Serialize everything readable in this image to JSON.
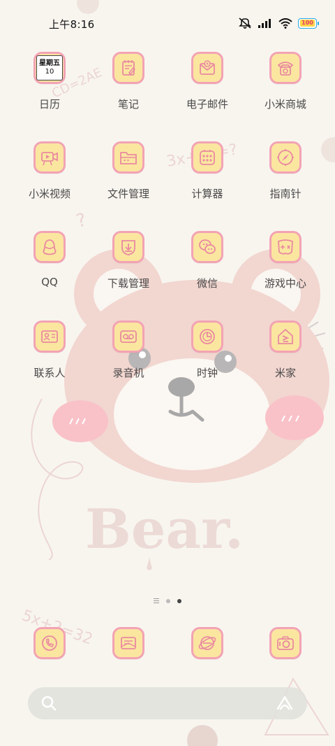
{
  "status_bar": {
    "time": "上午8:16",
    "battery_level": "100",
    "icons": [
      "mute-icon",
      "signal-icon",
      "wifi-icon",
      "battery-icon"
    ]
  },
  "calendar_icon": {
    "weekday": "星期五",
    "day": "10"
  },
  "apps": [
    {
      "label": "日历",
      "icon": "calendar-icon"
    },
    {
      "label": "笔记",
      "icon": "notes-icon"
    },
    {
      "label": "电子邮件",
      "icon": "email-icon"
    },
    {
      "label": "小米商城",
      "icon": "telephone-icon"
    },
    {
      "label": "小米视频",
      "icon": "video-camera-icon"
    },
    {
      "label": "文件管理",
      "icon": "folder-icon"
    },
    {
      "label": "计算器",
      "icon": "calculator-icon"
    },
    {
      "label": "指南针",
      "icon": "compass-icon"
    },
    {
      "label": "QQ",
      "icon": "penguin-icon"
    },
    {
      "label": "下载管理",
      "icon": "download-icon"
    },
    {
      "label": "微信",
      "icon": "chat-bubbles-icon"
    },
    {
      "label": "游戏中心",
      "icon": "game-icon"
    },
    {
      "label": "联系人",
      "icon": "contact-card-icon"
    },
    {
      "label": "录音机",
      "icon": "recorder-icon"
    },
    {
      "label": "时钟",
      "icon": "clock-icon"
    },
    {
      "label": "米家",
      "icon": "home-icon"
    }
  ],
  "dock": [
    {
      "icon": "phone-icon"
    },
    {
      "icon": "messages-icon"
    },
    {
      "icon": "browser-icon"
    },
    {
      "icon": "camera-icon"
    }
  ],
  "page_indicator": {
    "pages": 2,
    "active": 2
  },
  "search_bar": {
    "left_icon": "search-icon",
    "right_icon": "assistant-icon"
  },
  "wallpaper": {
    "text": "Bear.",
    "doodles": [
      "CD=2AE",
      "3x+2y=?",
      "5x+2=32",
      "?"
    ]
  },
  "colors": {
    "icon_fill": "#fbe6a0",
    "icon_border": "#f3a3b4",
    "icon_stroke": "#e98aa0",
    "background": "#f8f5ef",
    "bear": "#f2d6d0"
  }
}
